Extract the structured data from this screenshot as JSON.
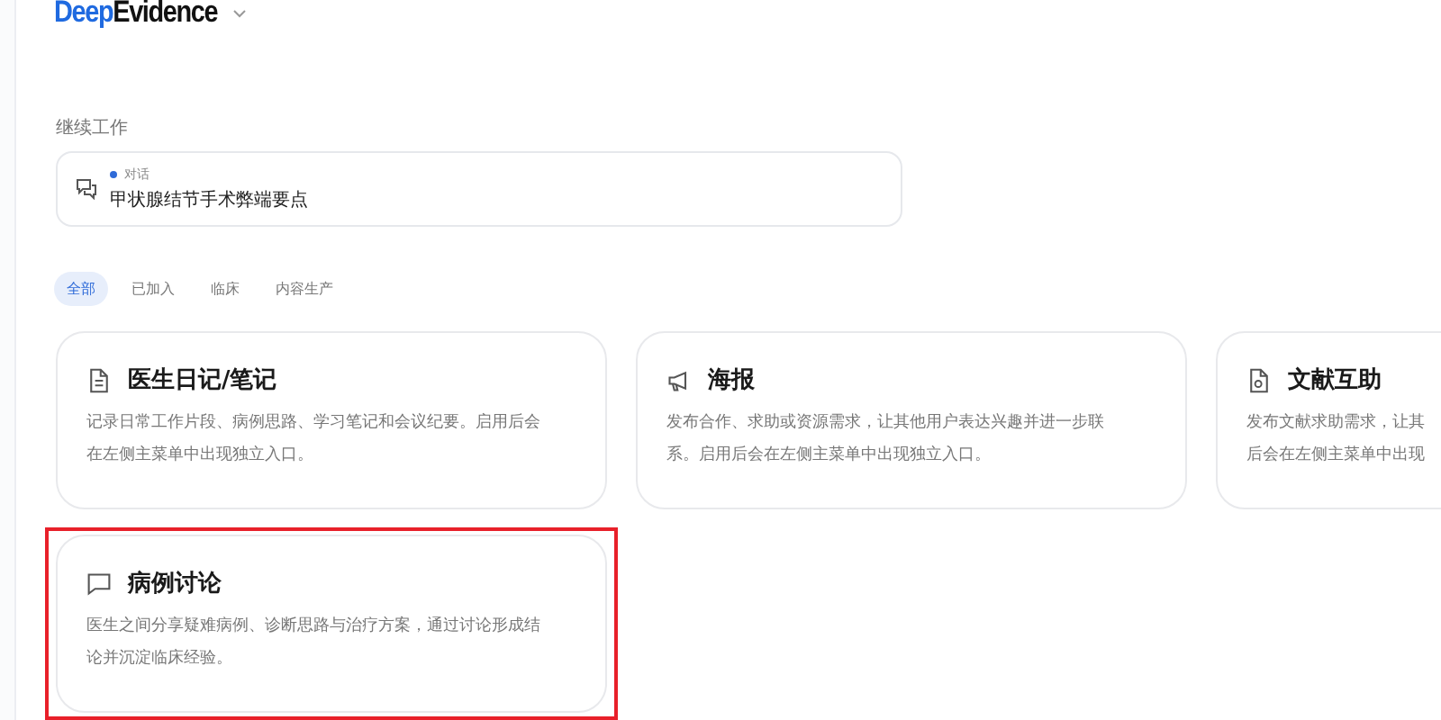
{
  "logo": {
    "accent": "Deep",
    "rest": "Evidence"
  },
  "continue_section": {
    "title": "继续工作",
    "items": [
      {
        "type": "对话",
        "title": "甲状腺结节手术弊端要点",
        "color": "#2f6bd8"
      }
    ]
  },
  "filter_tabs": [
    {
      "label": "全部",
      "selected": true
    },
    {
      "label": "已加入",
      "selected": false
    },
    {
      "label": "临床",
      "selected": false
    },
    {
      "label": "内容生产",
      "selected": false
    }
  ],
  "cards": [
    {
      "kind": "document",
      "title": "医生日记/笔记",
      "lines": [
        "记录日常工作片段、病例思路、学习笔记和会议纪要。启用后会",
        "在左侧主菜单中出现独立入口。"
      ],
      "highlighted": false
    },
    {
      "kind": "megaphone",
      "title": "海报",
      "lines": [
        "发布合作、求助或资源需求，让其他用户表达兴趣并进一步联",
        "系。启用后会在左侧主菜单中出现独立入口。"
      ],
      "highlighted": false
    },
    {
      "kind": "search-doc",
      "title": "文献互助",
      "lines": [
        "发布文献求助需求，让其",
        "后会在左侧主菜单中出现"
      ],
      "highlighted": false
    },
    {
      "kind": "chat",
      "title": "病例讨论",
      "lines": [
        "医生之间分享疑难病例、诊断思路与治疗方案，通过讨论形成结",
        "论并沉淀临床经验。"
      ],
      "highlighted": true
    }
  ]
}
